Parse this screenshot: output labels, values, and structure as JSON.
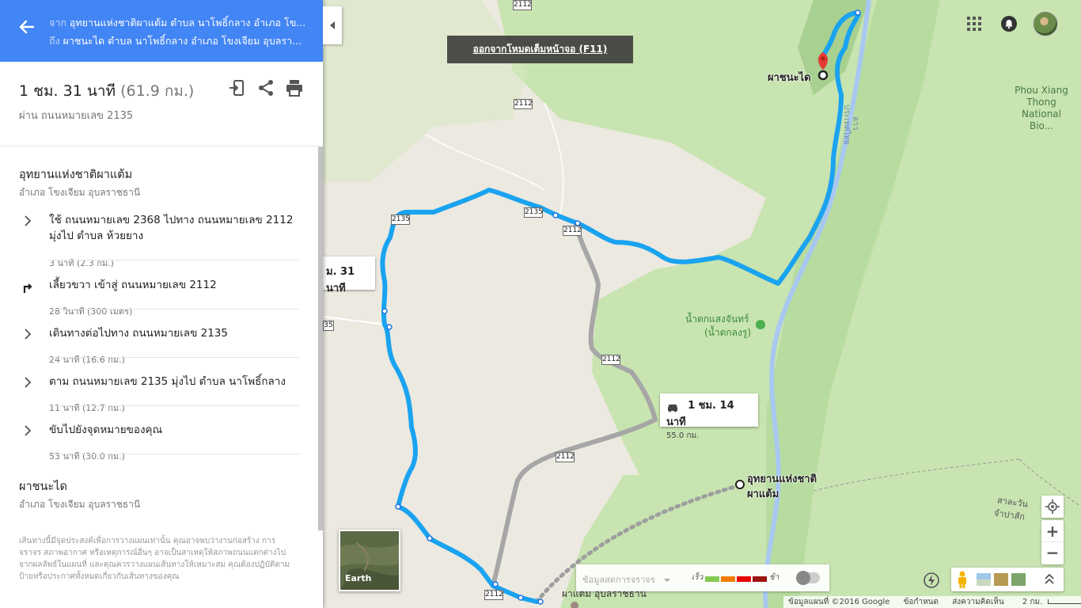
{
  "header": {
    "from_prefix": "จาก",
    "from_place": "อุทยานแห่งชาติผาแต้ม ตำบล นาโพธิ์กลาง อำเภอ โข...",
    "to_prefix": "ถึง",
    "to_place": "ผาชนะได ตำบล นาโพธิ์กลาง อำเภอ โขงเจียม อุบลรา..."
  },
  "summary": {
    "time": "1 ชม. 31 นาที",
    "distance": "(61.9 กม.)",
    "via": "ผ่าน ถนนหมายเลข 2135"
  },
  "origin": {
    "title": "อุทยานแห่งชาติผาแต้ม",
    "sub": "อำเภอ โขงเจียม อุบลราชธานี"
  },
  "steps": [
    {
      "icon": "chevron-right-icon",
      "text": "ใช้ ถนนหมายเลข 2368 ไปทาง ถนนหมายเลข 2112 มุ่งไป ตำบล ห้วยยาง",
      "meta": "3 นาที (2.3 กม.)"
    },
    {
      "icon": "turn-right-icon",
      "text": "เลี้ยวขวา เข้าสู่ ถนนหมายเลข 2112",
      "meta": "28 วินาที (300 เมตร)"
    },
    {
      "icon": "chevron-right-icon",
      "text": "เดินทางต่อไปทาง ถนนหมายเลข 2135",
      "meta": "24 นาที (16.6 กม.)"
    },
    {
      "icon": "chevron-right-icon",
      "text": "ตาม ถนนหมายเลข 2135 มุ่งไป ตำบล นาโพธิ์กลาง",
      "meta": "11 นาที (12.7 กม.)"
    },
    {
      "icon": "chevron-right-icon",
      "text": "ขับไปยังจุดหมายของคุณ",
      "meta": "53 นาที (30.0 กม.)"
    }
  ],
  "destination": {
    "title": "ผาชนะได",
    "sub": "อำเภอ โขงเจียม อุบลราชธานี"
  },
  "disclaimer": "เส้นทางนี้มีจุดประสงค์เพื่อการวางแผนเท่านั้น คุณอาจพบว่างานก่อสร้าง การจราจร สภาพอากาศ หรือเหตุการณ์อื่นๆ อาจเป็นสาเหตุให้สภาพถนนแตกต่างไปจากผลลัพธ์ในแผนที่ และคุณควรวางแผนเส้นทางให้เหมาะสม คุณต้องปฏิบัติตามป้ายหรือประกาศทั้งหมดเกี่ยวกับเส้นทางของคุณ",
  "fullscreen_notice": "ออกจากโหมดเต็มหน้าจอ (F11)",
  "map": {
    "dest_label": "ผาชนะได",
    "origin_label_1": "อุทยานแห่งชาติ",
    "origin_label_2": "ผาแต้ม",
    "park_label": "Phou Xiang Thong National Bio...",
    "waterfall_1": "น้ำตกแสงจันทร์",
    "waterfall_2": "(น้ำตกลงรู)",
    "bottom_place": "ผาแต้ม อุบลราชธานี",
    "lao_label_1": "สาละวัน",
    "lao_label_2": "จำปาสัก",
    "river_label": "ประเทศไทย",
    "river_label_2": "ลาว",
    "route_main_label": "ม. 31 นาที",
    "route_alt_time": "1 ชม. 14 นาที",
    "route_alt_dist": "55.0 กม.",
    "shields": [
      "2112",
      "2112",
      "2135",
      "2135",
      "2112",
      "2112",
      "2112",
      "2112",
      "35"
    ]
  },
  "controls": {
    "earth_label": "Earth",
    "traffic_placeholder": "ข้อมูลสดการจราจร",
    "traffic_fast": "เร็ว",
    "traffic_slow": "ช้า",
    "zoom_in": "+",
    "zoom_out": "−"
  },
  "footer": {
    "copyright": "ข้อมูลแผนที่ ©2016 Google",
    "terms": "ข้อกำหนด",
    "feedback": "ส่งความคิดเห็น",
    "scale": "2 กม."
  },
  "colors": {
    "header_bg": "#4285f4",
    "route_main": "#1aa3f0",
    "route_alt": "#a6a6a6",
    "forest": "#c8e4b0",
    "river": "#a8c8f0"
  }
}
